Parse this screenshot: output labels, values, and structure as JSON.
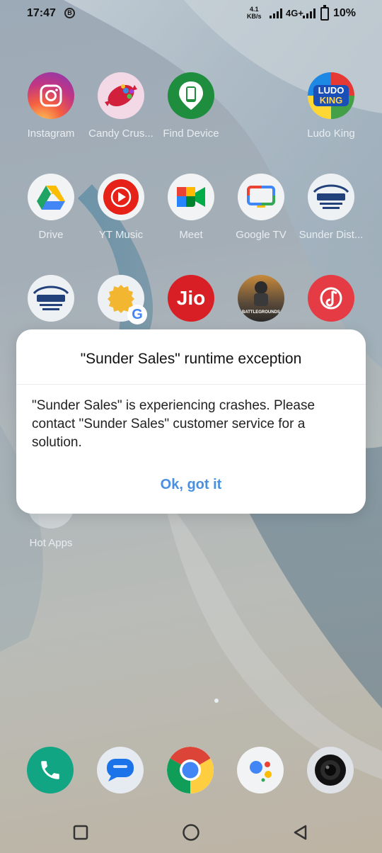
{
  "status_bar": {
    "time": "17:47",
    "notification_badge": "B",
    "net_speed_value": "4.1",
    "net_speed_unit": "KB/s",
    "network_type": "4G+",
    "battery": "10%"
  },
  "apps": {
    "instagram": "Instagram",
    "candy_crush": "Candy Crus...",
    "find_device": "Find Device",
    "ludo_king": "Ludo King",
    "drive": "Drive",
    "yt_music": "YT Music",
    "meet": "Meet",
    "google_tv": "Google TV",
    "sunder_dist": "Sunder Dist...",
    "hot_apps": "Hot Apps"
  },
  "icon_text": {
    "ludo": "LUDO",
    "king": "KING",
    "jio": "Jio",
    "bgmi": "BATTLEGROUNDS",
    "google_g": "G"
  },
  "dialog": {
    "title": "\"Sunder Sales\" runtime exception",
    "message": "\"Sunder Sales\" is experiencing crashes. Please contact \"Sunder Sales\" customer service for a solution.",
    "ok_label": "Ok, got it"
  },
  "colors": {
    "accent": "#4a8fe0",
    "dialog_bg": "#ffffff"
  },
  "icons": [
    "instagram-icon",
    "candy-crush-icon",
    "find-device-icon",
    "ludo-king-icon",
    "drive-icon",
    "yt-music-icon",
    "meet-icon",
    "google-tv-icon",
    "sunder-distributor-icon",
    "sudhamit-icon",
    "google-g-icon",
    "jio-icon",
    "bgmi-icon",
    "jiosaavn-icon",
    "phone-icon",
    "messages-icon",
    "chrome-icon",
    "assistant-icon",
    "camera-icon",
    "recents-icon",
    "home-icon",
    "back-icon"
  ]
}
